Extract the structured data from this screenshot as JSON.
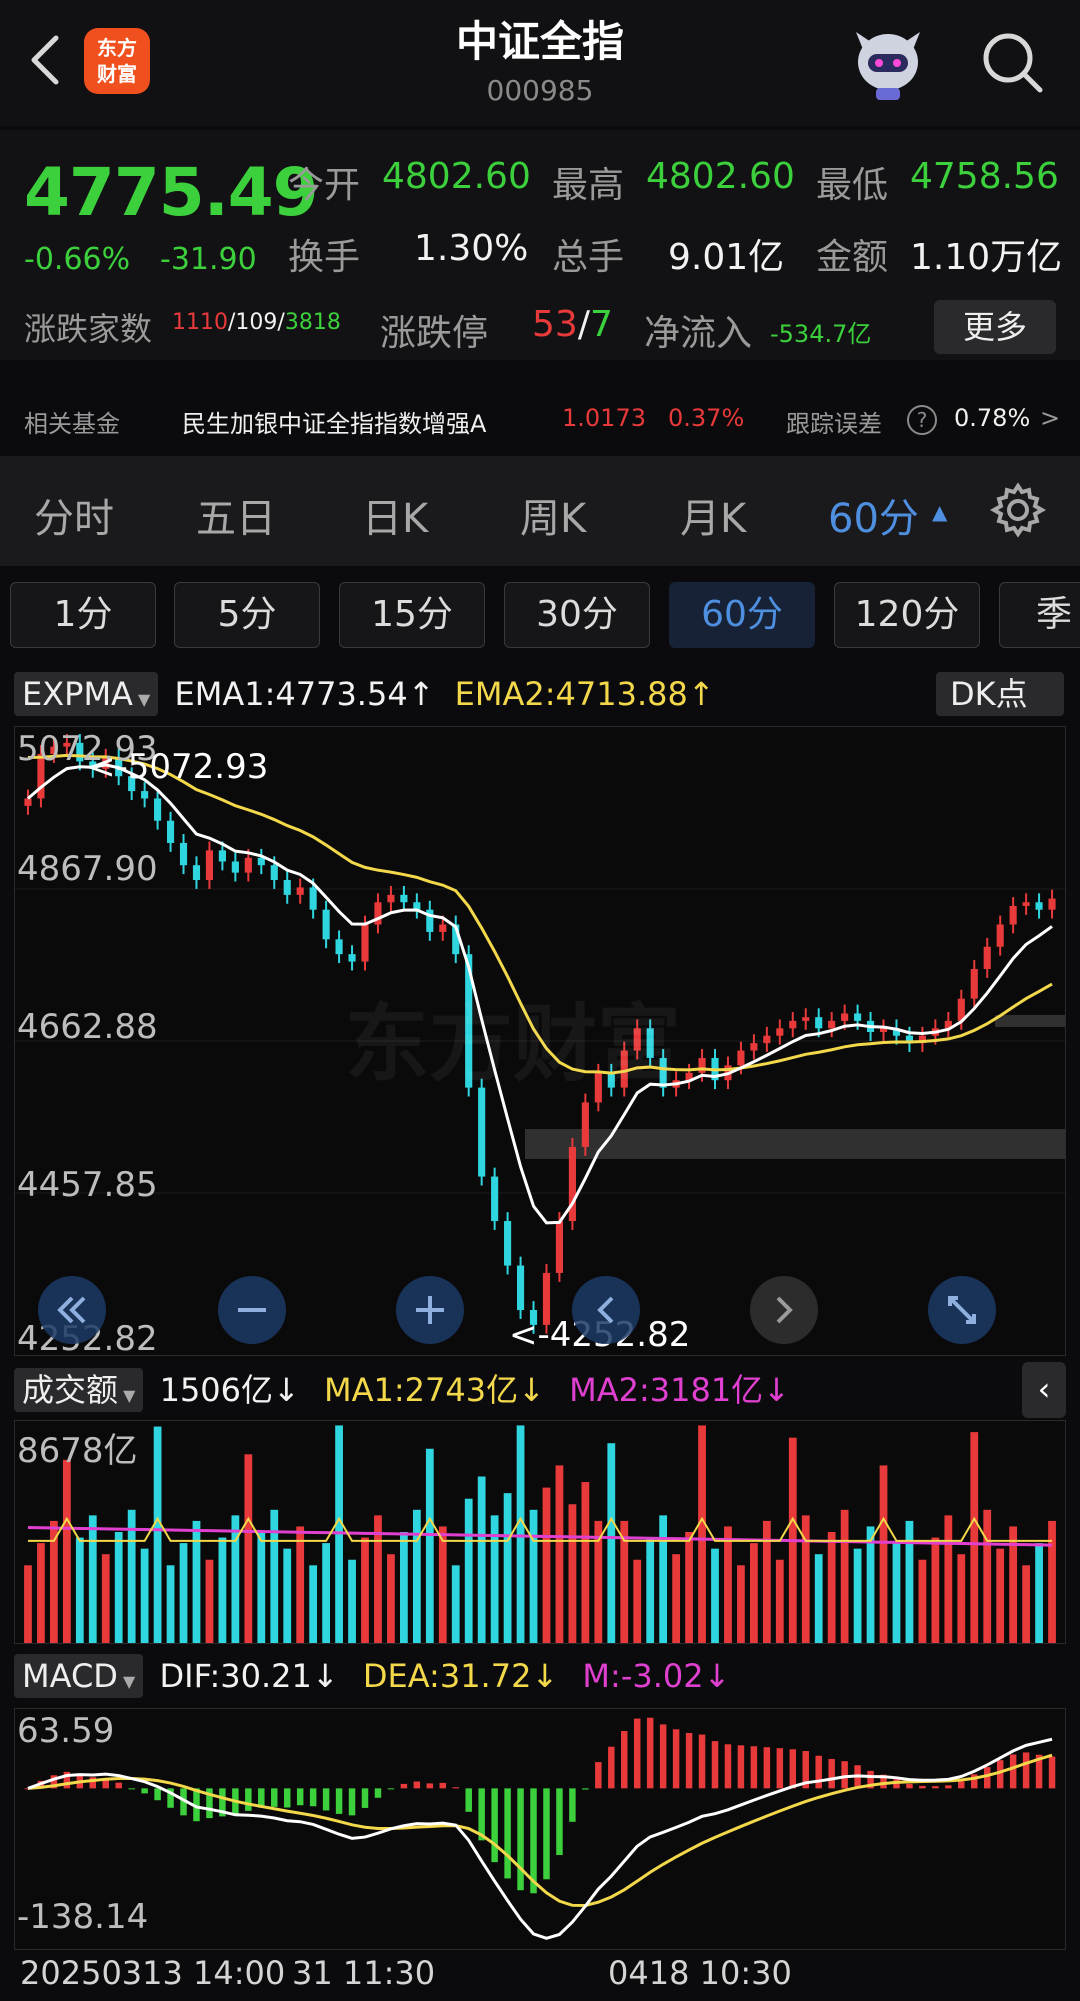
{
  "header": {
    "logo_line1": "东方",
    "logo_line2": "财富",
    "title": "中证全指",
    "code": "000985"
  },
  "quote": {
    "price": "4775.49",
    "change_pct": "-0.66%",
    "change_abs": "-31.90",
    "open_label": "今开",
    "open_value": "4802.60",
    "high_label": "最高",
    "high_value": "4802.60",
    "low_label": "最低",
    "low_value": "4758.56",
    "turnover_label": "换手",
    "turnover_value": "1.30%",
    "volume_label": "总手",
    "volume_value": "9.01亿",
    "amount_label": "金额",
    "amount_value": "1.10万亿",
    "breadth_label": "涨跌家数",
    "breadth_up": "1110",
    "breadth_flat": "109",
    "breadth_down": "3818",
    "limit_label": "涨跌停",
    "limit_up": "53",
    "limit_down": "7",
    "netflow_label": "净流入",
    "netflow_value": "-534.7亿",
    "more_button": "更多"
  },
  "fund": {
    "label": "相关基金",
    "name": "民生加银中证全指指数增强A",
    "nav": "1.0173",
    "pct": "0.37%",
    "track_label": "跟踪误差",
    "track_value": "0.78%"
  },
  "period_tabs": [
    "分时",
    "五日",
    "日K",
    "周K",
    "月K",
    "60分"
  ],
  "minute_tabs": [
    "1分",
    "5分",
    "15分",
    "30分",
    "60分",
    "120分",
    "季"
  ],
  "main_indicator": {
    "name": "EXPMA",
    "ema1": "EMA1:4773.54↑",
    "ema2": "EMA2:4713.88↑",
    "dk_button": "DK点",
    "y_labels": [
      "5072.93",
      "4867.90",
      "4662.88",
      "4457.85",
      "4252.82"
    ],
    "high_mark": "<-5072.93",
    "low_mark": "<-4252.82",
    "watermark": "东方财富"
  },
  "volume_indicator": {
    "name": "成交额",
    "value": "1506亿↓",
    "ma1": "MA1:2743亿↓",
    "ma2": "MA2:3181亿↓",
    "y_label": "8678亿"
  },
  "macd_indicator": {
    "name": "MACD",
    "dif": "DIF:30.21↓",
    "dea": "DEA:31.72↓",
    "m": "M:-3.02↓",
    "y_top": "63.59",
    "y_bottom": "-138.14"
  },
  "footer": {
    "start": "20250313 14:00",
    "mid1": "31 11:30",
    "mid2": "0418 10:30"
  },
  "colors": {
    "up": "#e83a3a",
    "down": "#3cd03c",
    "candle_down": "#2fd6e0",
    "accent": "#4f8fe0",
    "ema1": "#ffffff",
    "ema2": "#f2d84a",
    "ma2": "#e040d0"
  },
  "chart_data": [
    {
      "type": "candlestick",
      "title": "EXPMA",
      "ylim": [
        4252.82,
        5072.93
      ],
      "close": [
        4990,
        5050,
        5060,
        5065,
        5040,
        5030,
        5045,
        5020,
        5000,
        4990,
        4960,
        4930,
        4900,
        4880,
        4920,
        4905,
        4890,
        4910,
        4900,
        4880,
        4860,
        4870,
        4840,
        4800,
        4780,
        4770,
        4820,
        4850,
        4860,
        4850,
        4840,
        4810,
        4820,
        4780,
        4600,
        4480,
        4420,
        4360,
        4300,
        4280,
        4350,
        4420,
        4520,
        4580,
        4620,
        4600,
        4650,
        4680,
        4640,
        4600,
        4610,
        4620,
        4640,
        4610,
        4630,
        4650,
        4660,
        4670,
        4680,
        4690,
        4695,
        4680,
        4690,
        4700,
        4690,
        4675,
        4680,
        4670,
        4660,
        4670,
        4680,
        4690,
        4720,
        4760,
        4790,
        4820,
        4845,
        4850,
        4840,
        4855
      ],
      "ema1_end": 4773.54,
      "ema2_end": 4713.88
    },
    {
      "type": "bar",
      "title": "成交额",
      "ylim": [
        0,
        8678
      ],
      "series": [
        {
          "name": "MA1",
          "end_value": 2743
        },
        {
          "name": "MA2",
          "end_value": 3181
        }
      ]
    },
    {
      "type": "bar",
      "title": "MACD",
      "ylim": [
        -138.14,
        63.59
      ],
      "series": [
        {
          "name": "DIF",
          "end_value": 30.21
        },
        {
          "name": "DEA",
          "end_value": 31.72
        },
        {
          "name": "M",
          "end_value": -3.02
        }
      ]
    }
  ]
}
